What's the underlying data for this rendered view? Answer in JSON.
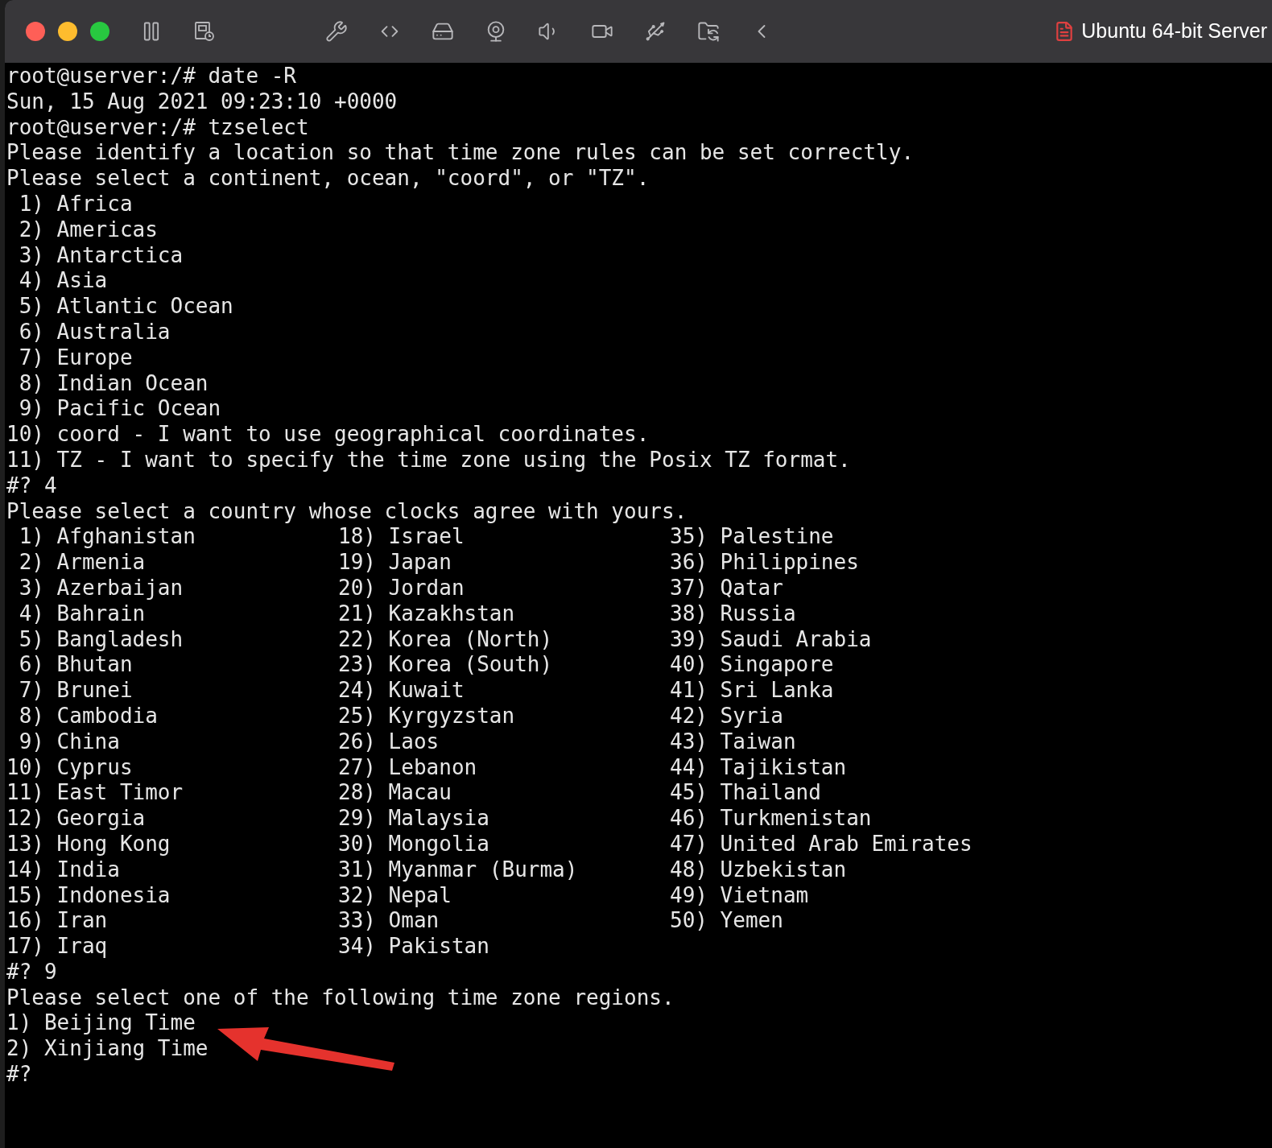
{
  "window": {
    "title": "Ubuntu 64-bit Server"
  },
  "terminal": {
    "blocks": [
      {
        "kind": "lines",
        "lines": [
          "root@userver:/# date -R",
          "Sun, 15 Aug 2021 09:23:10 +0000",
          "root@userver:/# tzselect",
          "Please identify a location so that time zone rules can be set correctly.",
          "Please select a continent, ocean, \"coord\", or \"TZ\".",
          " 1) Africa",
          " 2) Americas",
          " 3) Antarctica",
          " 4) Asia",
          " 5) Atlantic Ocean",
          " 6) Australia",
          " 7) Europe",
          " 8) Indian Ocean",
          " 9) Pacific Ocean",
          "10) coord - I want to use geographical coordinates.",
          "11) TZ - I want to specify the time zone using the Posix TZ format.",
          "#? 4",
          "Please select a country whose clocks agree with yours."
        ]
      },
      {
        "kind": "columns",
        "rows": [
          [
            " 1) Afghanistan",
            "18) Israel",
            "35) Palestine"
          ],
          [
            " 2) Armenia",
            "19) Japan",
            "36) Philippines"
          ],
          [
            " 3) Azerbaijan",
            "20) Jordan",
            "37) Qatar"
          ],
          [
            " 4) Bahrain",
            "21) Kazakhstan",
            "38) Russia"
          ],
          [
            " 5) Bangladesh",
            "22) Korea (North)",
            "39) Saudi Arabia"
          ],
          [
            " 6) Bhutan",
            "23) Korea (South)",
            "40) Singapore"
          ],
          [
            " 7) Brunei",
            "24) Kuwait",
            "41) Sri Lanka"
          ],
          [
            " 8) Cambodia",
            "25) Kyrgyzstan",
            "42) Syria"
          ],
          [
            " 9) China",
            "26) Laos",
            "43) Taiwan"
          ],
          [
            "10) Cyprus",
            "27) Lebanon",
            "44) Tajikistan"
          ],
          [
            "11) East Timor",
            "28) Macau",
            "45) Thailand"
          ],
          [
            "12) Georgia",
            "29) Malaysia",
            "46) Turkmenistan"
          ],
          [
            "13) Hong Kong",
            "30) Mongolia",
            "47) United Arab Emirates"
          ],
          [
            "14) India",
            "31) Myanmar (Burma)",
            "48) Uzbekistan"
          ],
          [
            "15) Indonesia",
            "32) Nepal",
            "49) Vietnam"
          ],
          [
            "16) Iran",
            "33) Oman",
            "50) Yemen"
          ],
          [
            "17) Iraq",
            "34) Pakistan"
          ]
        ]
      },
      {
        "kind": "lines",
        "lines": [
          "#? 9",
          "Please select one of the following time zone regions.",
          "1) Beijing Time",
          "2) Xinjiang Time",
          "#?"
        ]
      }
    ]
  }
}
